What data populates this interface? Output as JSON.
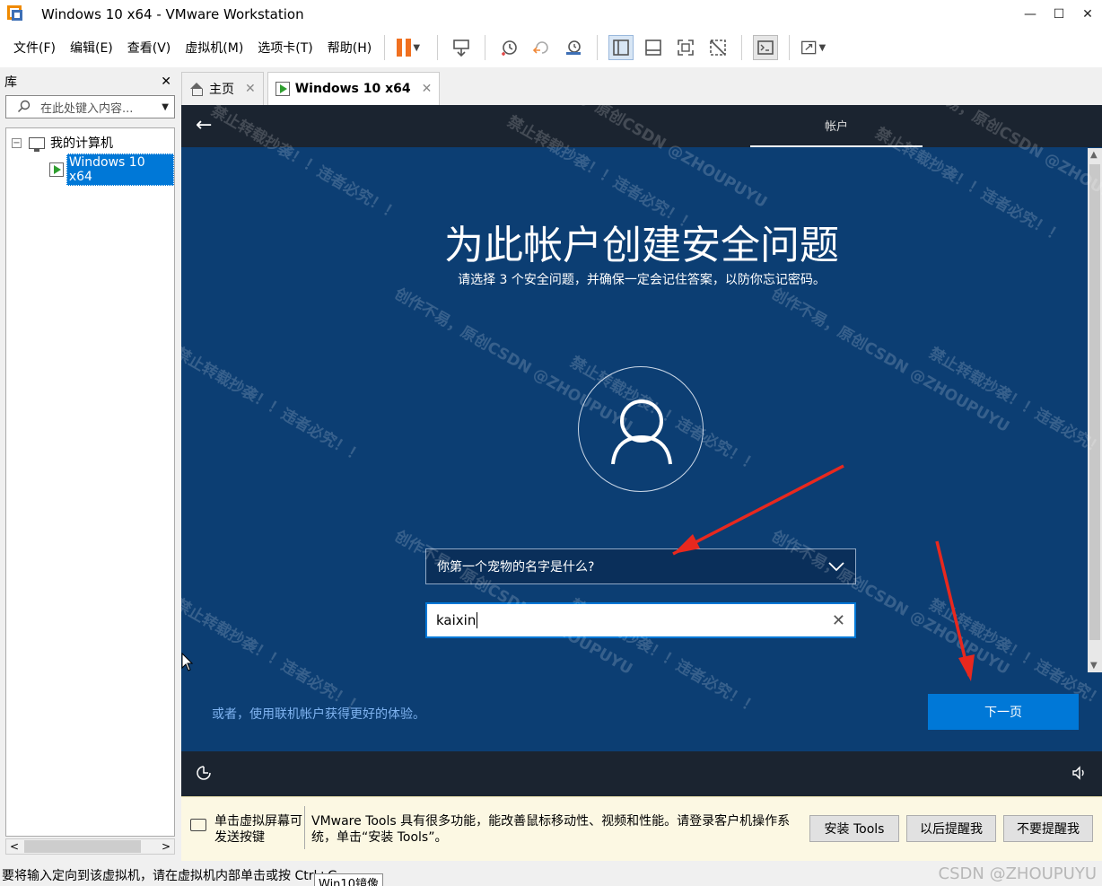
{
  "window": {
    "title": "Windows 10 x64 - VMware Workstation",
    "controls": [
      "—",
      "☐",
      "✕"
    ]
  },
  "menu": {
    "items": [
      "文件(F)",
      "编辑(E)",
      "查看(V)",
      "虚拟机(M)",
      "选项卡(T)",
      "帮助(H)"
    ]
  },
  "library": {
    "title": "库",
    "close": "✕",
    "search_placeholder": "在此处键入内容...",
    "tree": {
      "root_label": "我的计算机",
      "vm_label": "Windows 10 x64"
    }
  },
  "tabs": [
    {
      "label": "主页"
    },
    {
      "label": "Windows 10 x64"
    }
  ],
  "vm_screen": {
    "top_tab": "帐户",
    "title": "为此帐户创建安全问题",
    "subtitle": "请选择 3 个安全问题，并确保一定会记住答案，以防你忘记密码。",
    "question_value": "你第一个宠物的名字是什么?",
    "answer_value": "kaixin",
    "online_link": "或者，使用联机帐户获得更好的体验。",
    "next_button": "下一页",
    "watermark_a": "创作不易，原创CSDN @ZHOUPUYU",
    "watermark_b": "禁止转载抄袭！！违者必究！！"
  },
  "tools_bar": {
    "hint": "单击虚拟屏幕可发送按键",
    "message": "VMware Tools 具有很多功能，能改善鼠标移动性、视频和性能。请登录客户机操作系统，单击“安装 Tools”。",
    "install_button": "安装 Tools",
    "remind_later_button": "以后提醒我",
    "never_remind_button": "不要提醒我"
  },
  "status": {
    "text": "要将输入定向到该虚拟机，请在虚拟机内部单击或按 Ctrl+G。",
    "tooltip": "Win10镜像",
    "credit": "CSDN @ZHOUPUYU"
  },
  "colors": {
    "vm_background": "#0c3e73",
    "accent": "#0078d7",
    "pause": "#f07020"
  }
}
